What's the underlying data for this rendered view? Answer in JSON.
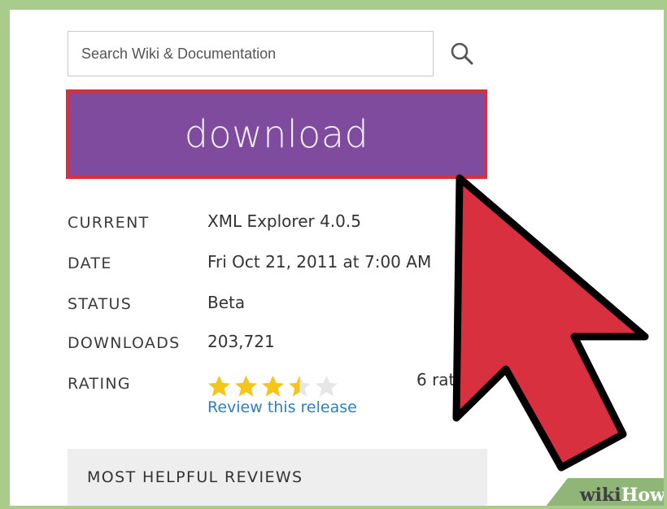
{
  "search": {
    "placeholder": "Search Wiki & Documentation"
  },
  "download": {
    "label": "download"
  },
  "release_info": [
    {
      "key": "CURRENT",
      "value": "XML Explorer 4.0.5"
    },
    {
      "key": "DATE",
      "value": "Fri Oct 21, 2011 at 7:00 AM"
    },
    {
      "key": "STATUS",
      "value": "Beta"
    },
    {
      "key": "DOWNLOADS",
      "value": "203,721"
    },
    {
      "key": "RATING",
      "value": ""
    }
  ],
  "rating": {
    "stars": 3.5,
    "max_stars": 5,
    "count_text": "6 rati",
    "review_link": "Review this release"
  },
  "reviews": {
    "title": "MOST HELPFUL REVIEWS"
  },
  "watermark": {
    "wiki": "wiki",
    "how": "How"
  },
  "colors": {
    "download_bg": "#7e4b9f",
    "highlight_border": "#d92e3c",
    "cursor_fill": "#d9303f",
    "star_filled": "#f5c518",
    "star_empty": "#e6e6e6",
    "link": "#2d7fc1",
    "frame_border": "#a9cc8c"
  }
}
